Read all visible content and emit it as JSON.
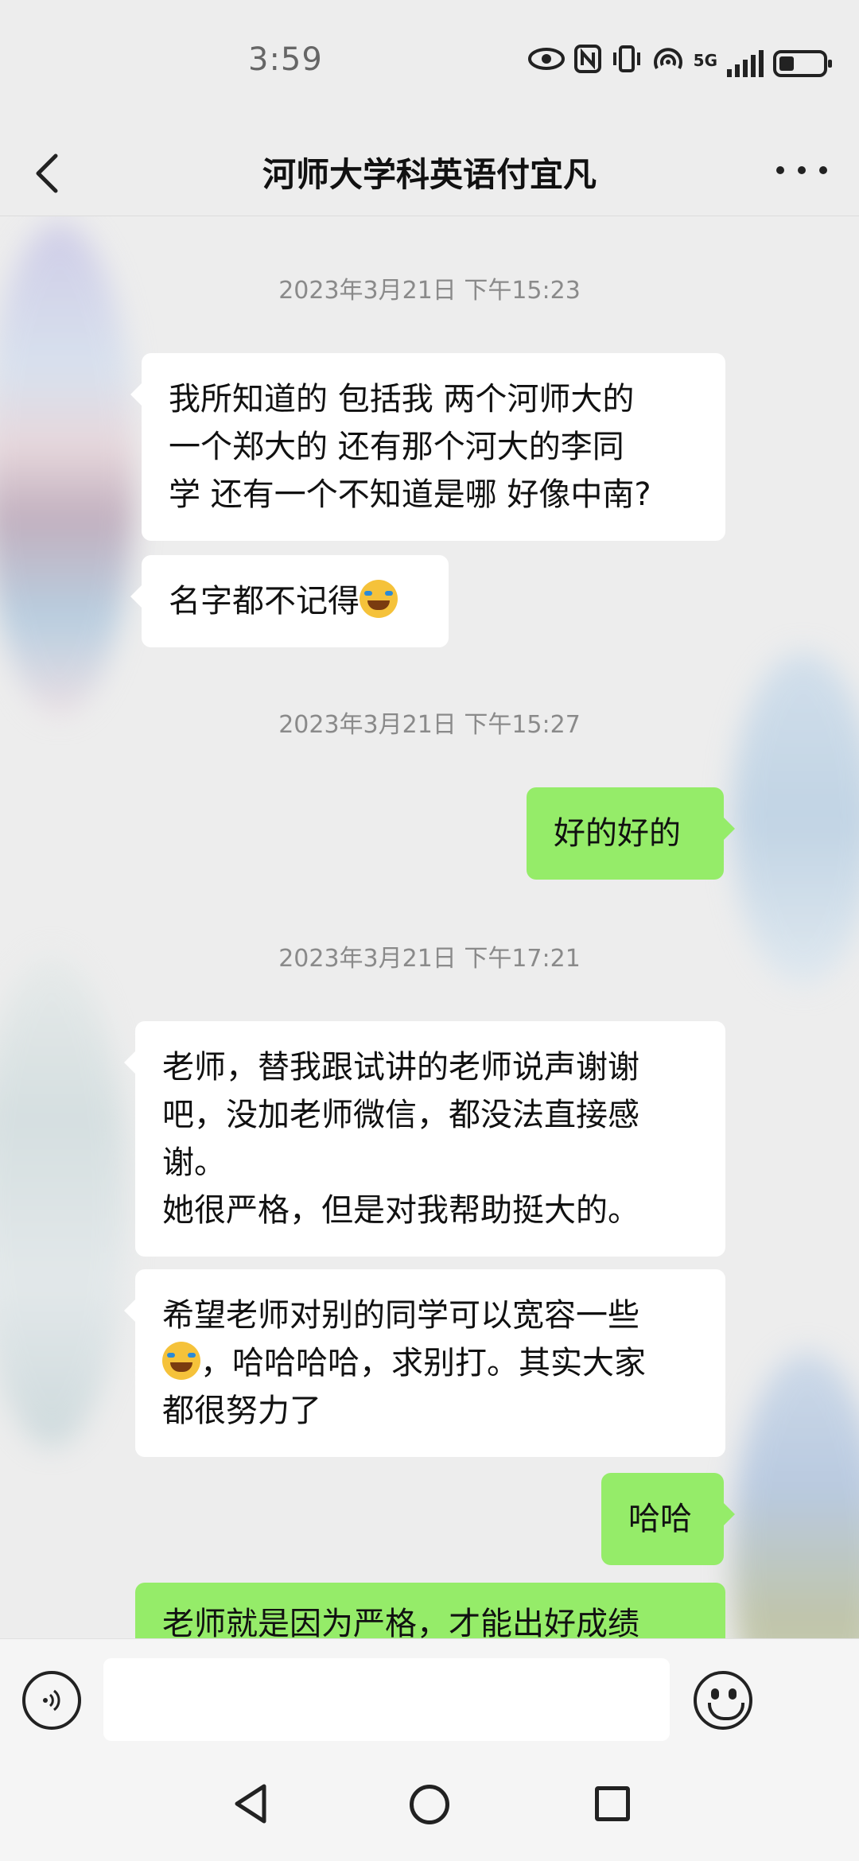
{
  "status_bar": {
    "time": "3:59",
    "network": "5G"
  },
  "header": {
    "title": "河师大学科英语付宜凡"
  },
  "messages": [
    {
      "type": "timestamp",
      "text": "2023年3月21日 下午15:23"
    },
    {
      "type": "received",
      "lines": [
        "我所知道的 包括我 两个河师大的",
        "一个郑大的 还有那个河大的李同",
        "学 还有一个不知道是哪 好像中南?"
      ]
    },
    {
      "type": "received",
      "text": "名字都不记得",
      "emoji": "facepalm-emoji"
    },
    {
      "type": "timestamp",
      "text": "2023年3月21日 下午15:27"
    },
    {
      "type": "sent",
      "text": "好的好的"
    },
    {
      "type": "timestamp",
      "text": "2023年3月21日 下午17:21"
    },
    {
      "type": "received",
      "lines": [
        "老师，替我跟试讲的老师说声谢谢",
        "吧，没加老师微信，都没法直接感",
        "谢。",
        "她很严格，但是对我帮助挺大的。"
      ]
    },
    {
      "type": "received",
      "line1": "希望老师对别的同学可以宽容一些",
      "line2_after_emoji": "，哈哈哈哈，求别打。其实大家",
      "line3": "都很努力了",
      "emoji": "facepalm-emoji"
    },
    {
      "type": "sent",
      "text": "哈哈"
    },
    {
      "type": "sent",
      "text": "老师就是因为严格，才能出好成绩"
    }
  ],
  "input_bar": {
    "placeholder": ""
  },
  "colors": {
    "background": "#ededed",
    "sent_bubble": "#95ec69",
    "received_bubble": "#ffffff",
    "timestamp_text": "#8a8a8a"
  }
}
